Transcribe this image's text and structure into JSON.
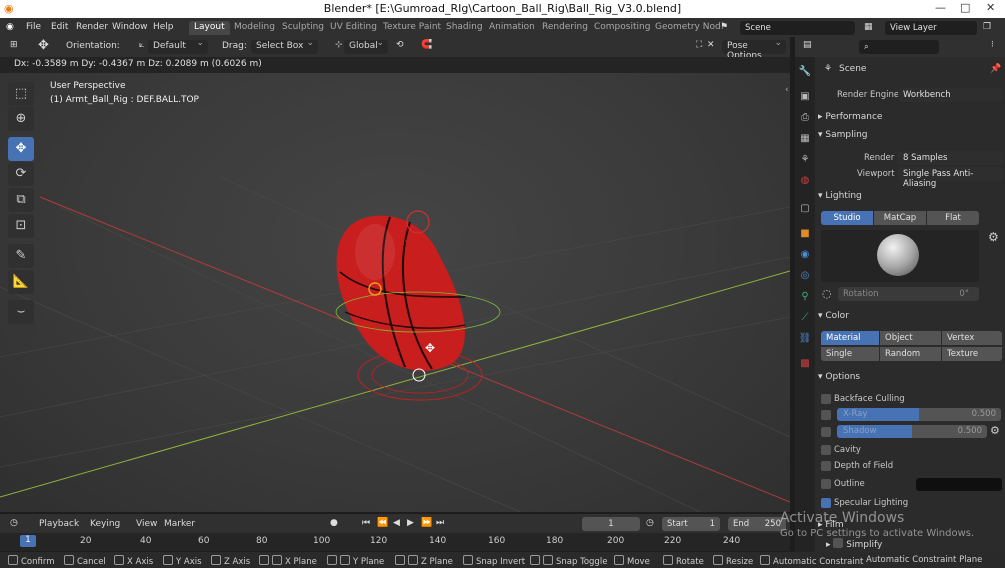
{
  "title": "Blender* [E:\\Gumroad_RIg\\Cartoon_Ball_Rig\\Ball_Rig_V3.0.blend]",
  "window_controls": {
    "minimize": "—",
    "maximize": "□",
    "close": "✕"
  },
  "menu": [
    "File",
    "Edit",
    "Render",
    "Window",
    "Help"
  ],
  "workspaces": [
    "Layout",
    "Modeling",
    "Sculpting",
    "UV Editing",
    "Texture Paint",
    "Shading",
    "Animation",
    "Rendering",
    "Compositing",
    "Geometry Nod"
  ],
  "scene_field": "Scene",
  "view_layer_field": "View Layer",
  "header": {
    "orientation_label": "Orientation:",
    "orientation_value": "Default",
    "drag_label": "Drag:",
    "drag_value": "Select Box",
    "transform_value": "Global",
    "pose_options": "Pose Options"
  },
  "info": "Dx: -0.3589 m   Dy: -0.4367 m   Dz: 0.2089 m (0.6026 m)",
  "viewport": {
    "perspective": "User Perspective",
    "object": "(1) Armt_Ball_Rig : DEF.BALL.TOP"
  },
  "properties": {
    "context": "Scene",
    "render_engine_label": "Render Engine",
    "render_engine": "Workbench",
    "performance": "Performance",
    "sampling": "Sampling",
    "render_label": "Render",
    "render_samples": "8 Samples",
    "viewport_label": "Viewport",
    "viewport_aa": "Single Pass Anti-Aliasing",
    "lighting": "Lighting",
    "lighting_modes": [
      "Studio",
      "MatCap",
      "Flat"
    ],
    "rotation_label": "Rotation",
    "rotation_value": "0°",
    "color": "Color",
    "color_modes": [
      "Material",
      "Object",
      "Vertex",
      "Single",
      "Random",
      "Texture"
    ],
    "options": "Options",
    "backface": "Backface Culling",
    "xray_label": "X-Ray",
    "xray_value": "0.500",
    "xray_fraction": 0.5,
    "shadow_label": "Shadow",
    "shadow_value": "0.500",
    "shadow_fraction": 0.5,
    "cavity": "Cavity",
    "dof": "Depth of Field",
    "outline": "Outline",
    "specular": "Specular Lighting",
    "film": "Film",
    "simplify": "Simplify"
  },
  "timeline": {
    "playback": "Playback",
    "keying": "Keying",
    "view": "View",
    "marker": "Marker",
    "current_frame": "1",
    "start_label": "Start",
    "start": "1",
    "end_label": "End",
    "end": "250",
    "ticks": [
      "1",
      "20",
      "40",
      "60",
      "80",
      "100",
      "120",
      "140",
      "160",
      "180",
      "200",
      "220",
      "240"
    ]
  },
  "status": [
    {
      "key": "Confirm"
    },
    {
      "key": "Cancel"
    },
    {
      "key": "X Axis"
    },
    {
      "key": "Y Axis"
    },
    {
      "key": "Z Axis"
    },
    {
      "key": "X Plane"
    },
    {
      "key": "Y Plane"
    },
    {
      "key": "Z Plane"
    },
    {
      "key": "Snap Invert"
    },
    {
      "key": "Snap Toggle"
    },
    {
      "key": "Move"
    },
    {
      "key": "Rotate"
    },
    {
      "key": "Resize"
    },
    {
      "key": "Automatic Constraint"
    },
    {
      "key": "Automatic Constraint Plane"
    }
  ],
  "watermark": {
    "line1": "Activate Windows",
    "line2": "Go to PC settings to activate Windows."
  },
  "colors": {
    "accent": "#4772b3",
    "ball": "#c81e1e",
    "x_axis": "#b23a3a",
    "y_axis": "#8fb33a"
  }
}
